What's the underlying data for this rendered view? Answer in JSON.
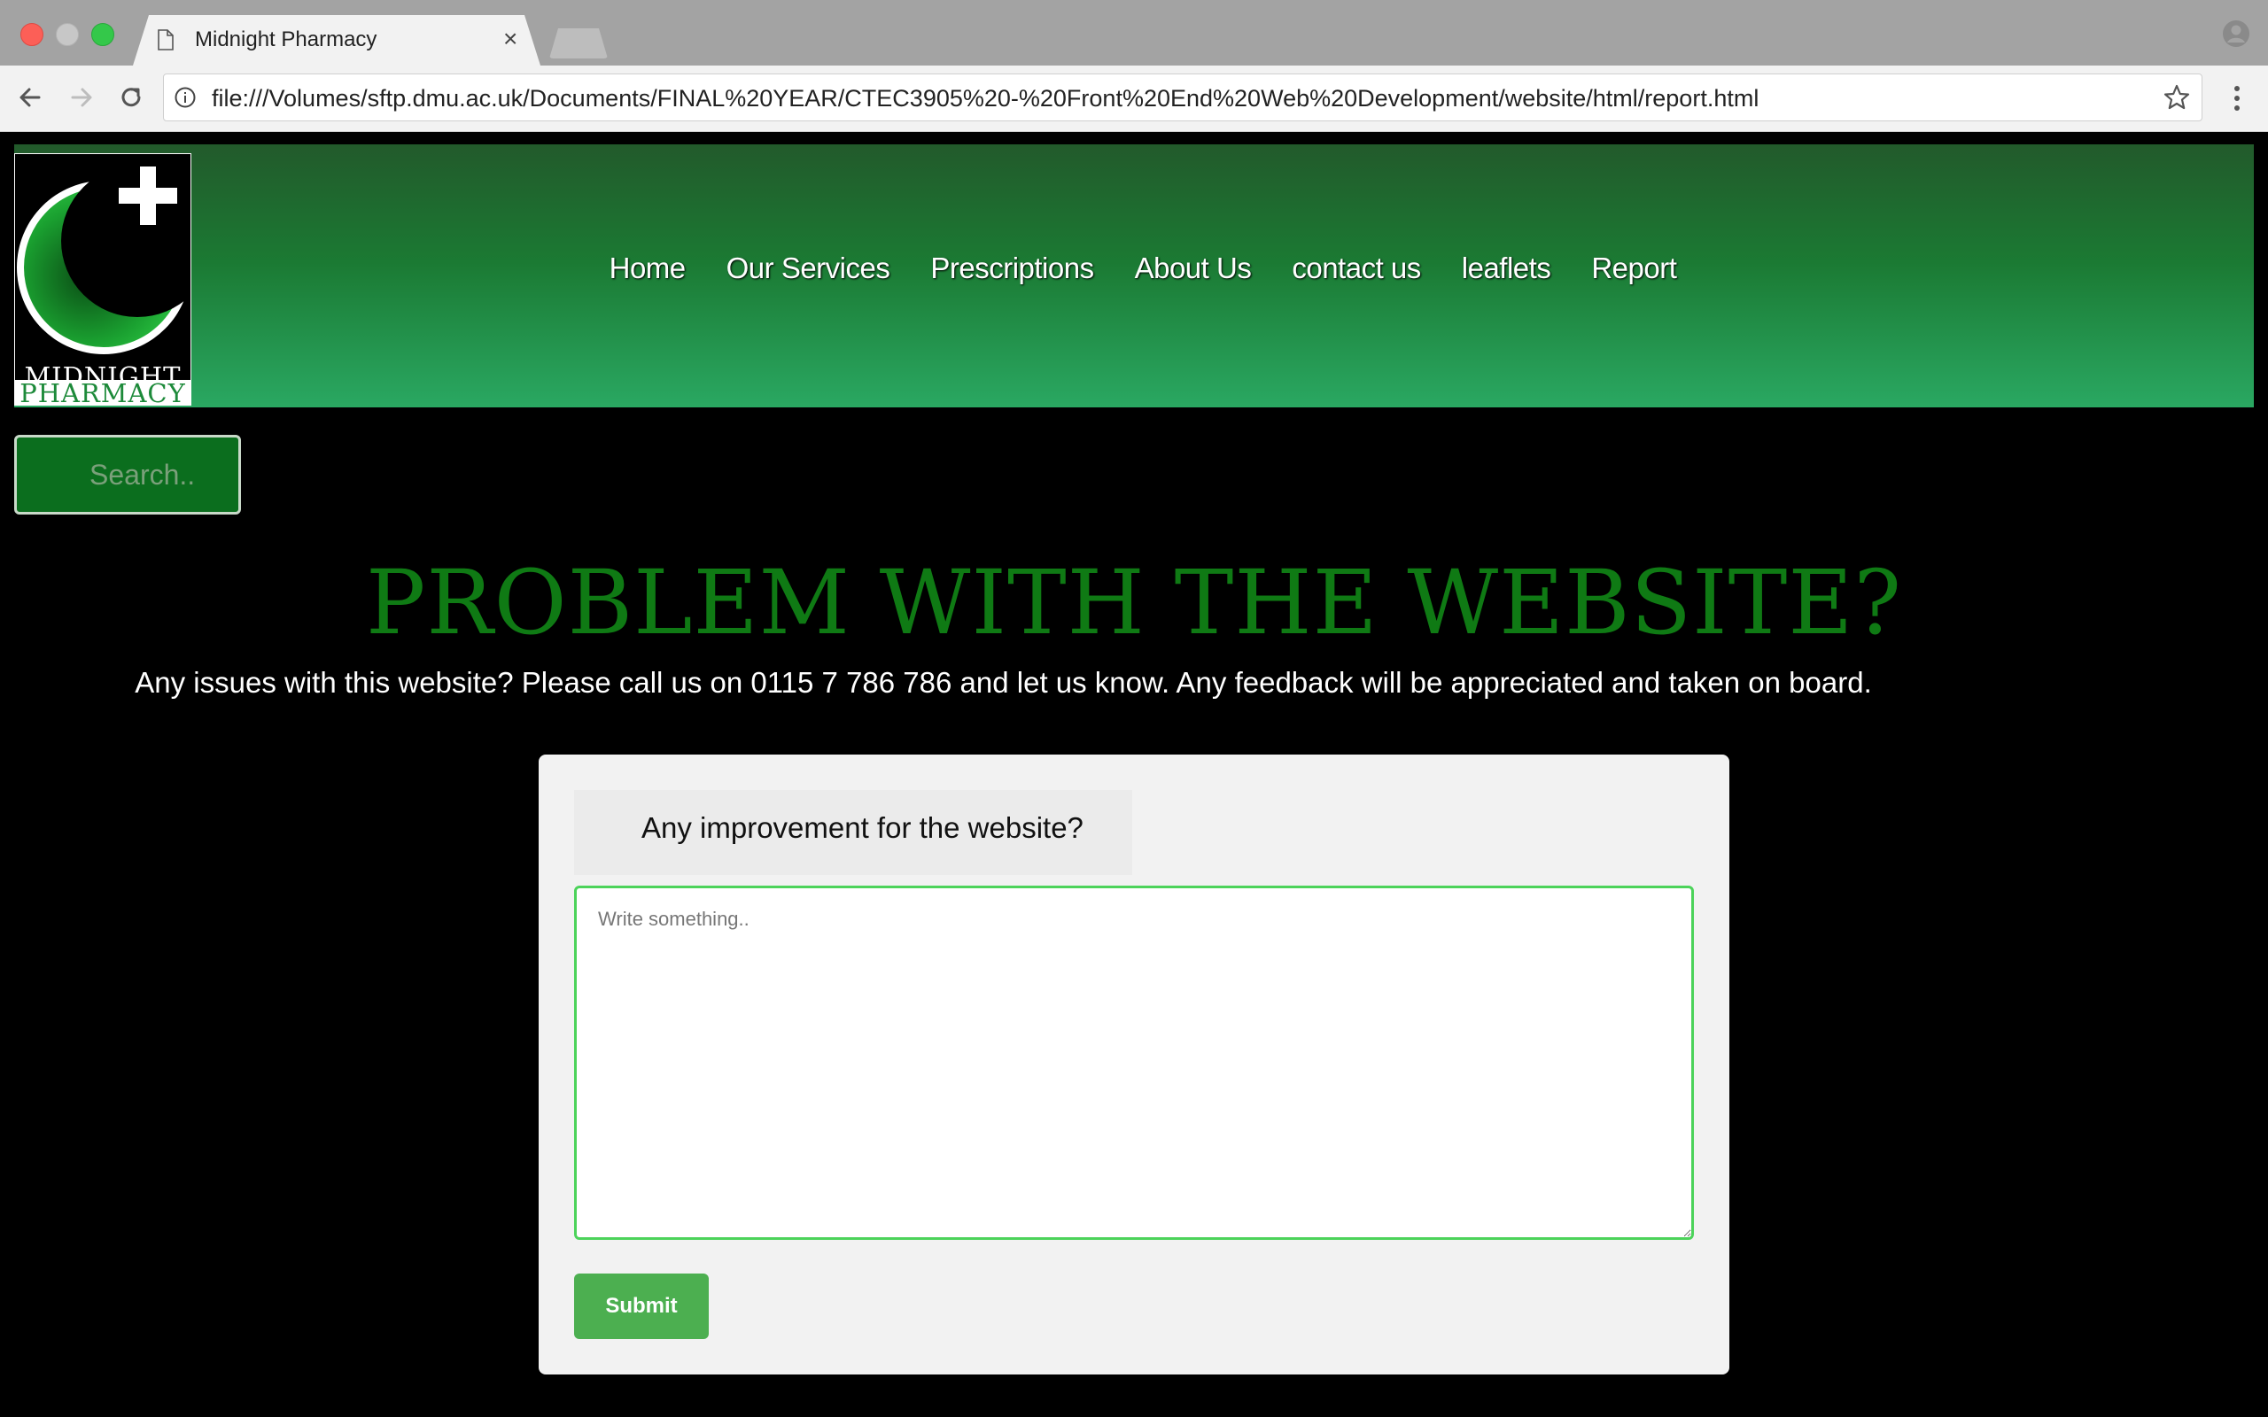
{
  "browser": {
    "tab_title": "Midnight Pharmacy",
    "tab_close": "×",
    "url": "file:///Volumes/sftp.dmu.ac.uk/Documents/FINAL%20YEAR/CTEC3905%20-%20Front%20End%20Web%20Development/website/html/report.html",
    "icons": [
      "back-icon",
      "forward-icon",
      "reload-icon",
      "info-icon",
      "star-icon",
      "menu-icon",
      "profile-icon",
      "document-icon"
    ]
  },
  "logo": {
    "line1": "MIDNIGHT",
    "line2": "PHARMACY"
  },
  "nav": {
    "items": [
      "Home",
      "Our Services",
      "Prescriptions",
      "About Us",
      "contact us",
      "leaflets",
      "Report"
    ]
  },
  "search": {
    "placeholder": "Search.."
  },
  "main": {
    "title": "PROBLEM WITH THE WEBSITE?",
    "intro": "Any issues with this website? Please call us on 0115 7 786 786 and let us know. Any feedback will be appreciated and taken on board."
  },
  "form": {
    "label": "Any improvement for the website?",
    "textarea_placeholder": "Write something..",
    "submit_label": "Submit"
  },
  "colors": {
    "accent_green": "#0f7a14",
    "header_gradient_top": "#225a2b",
    "header_gradient_bottom": "#2aa862",
    "submit_green": "#4caf50",
    "textarea_border": "#4cd35a"
  }
}
